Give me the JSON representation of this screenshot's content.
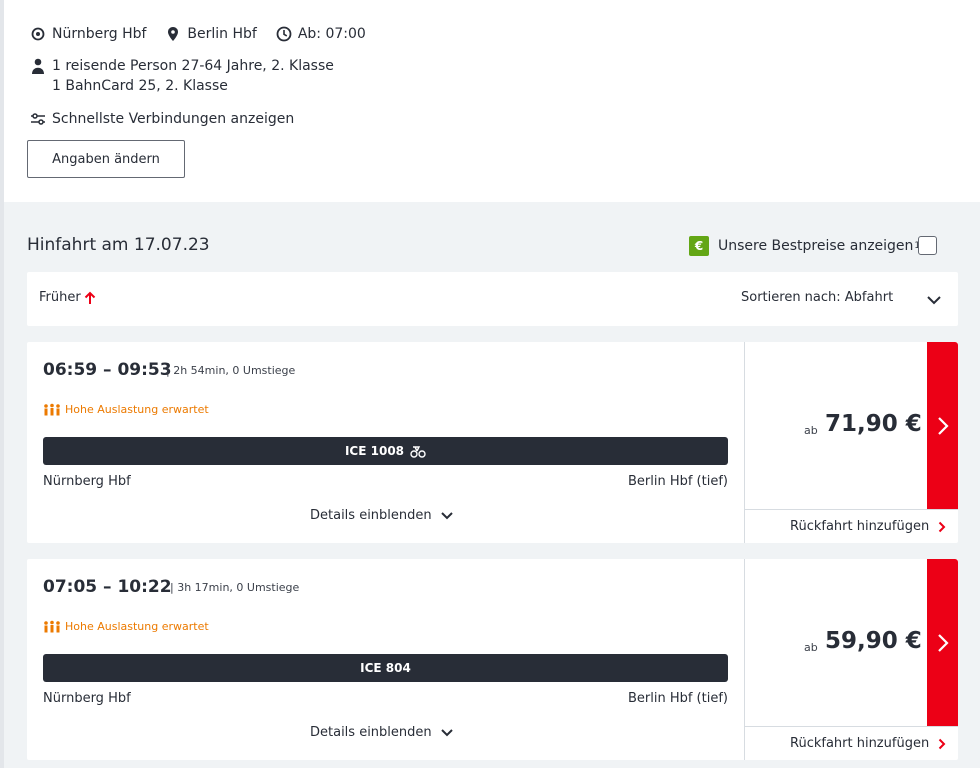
{
  "search": {
    "from": "Nürnberg Hbf",
    "to": "Berlin Hbf",
    "departure": "Ab: 07:00",
    "traveller_line1": "1 reisende Person 27-64 Jahre, 2. Klasse",
    "traveller_line2": "1 BahnCard 25, 2. Klasse",
    "filter": "Schnellste Verbindungen anzeigen",
    "change_button": "Angaben ändern"
  },
  "results": {
    "heading": "Hinfahrt am 17.07.23",
    "bestprice_label": "Unsere Bestpreise anzeigen",
    "bestprice_sup": "1",
    "bestprice_badge": "€",
    "earlier": "Früher",
    "sort_label": "Sortieren nach: Abfahrt"
  },
  "connections": [
    {
      "time": "06:59 – 09:53",
      "duration": "| 2h 54min, 0 Umstiege",
      "load": "Hohe Auslastung erwartet",
      "train": "ICE 1008",
      "from": "Nürnberg Hbf",
      "to": "Berlin Hbf (tief)",
      "details": "Details einblenden",
      "price_prefix": "ab",
      "price": "71,90 €",
      "return": "Rückfahrt hinzufügen"
    },
    {
      "time": "07:05 – 10:22",
      "duration": "| 3h 17min, 0 Umstiege",
      "load": "Hohe Auslastung erwartet",
      "train": "ICE 804",
      "from": "Nürnberg Hbf",
      "to": "Berlin Hbf (tief)",
      "details": "Details einblenden",
      "price_prefix": "ab",
      "price": "59,90 €",
      "return": "Rückfahrt hinzufügen"
    }
  ],
  "colors": {
    "accent_red": "#ec0016",
    "load_orange": "#ec7a00",
    "badge_green": "#63a615",
    "train_bar": "#282d37"
  }
}
